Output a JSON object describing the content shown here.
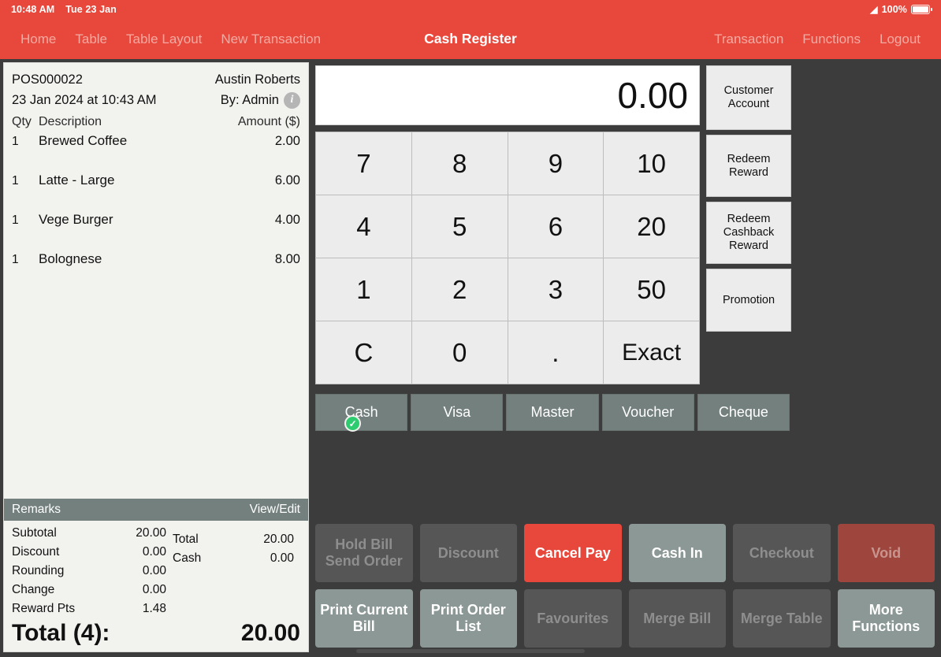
{
  "status_bar": {
    "time": "10:48 AM",
    "date": "Tue 23 Jan",
    "wifi_icon": "wifi-icon",
    "battery_percent": "100%"
  },
  "nav": {
    "title": "Cash Register",
    "left_items": [
      {
        "label": "Home",
        "name": "nav-home"
      },
      {
        "label": "Table",
        "name": "nav-table"
      },
      {
        "label": "Table Layout",
        "name": "nav-table-layout"
      },
      {
        "label": "New Transaction",
        "name": "nav-new-transaction"
      }
    ],
    "right_items": [
      {
        "label": "Transaction",
        "name": "nav-transaction"
      },
      {
        "label": "Functions",
        "name": "nav-functions"
      },
      {
        "label": "Logout",
        "name": "nav-logout"
      }
    ]
  },
  "receipt": {
    "order_no": "POS000022",
    "customer": "Austin Roberts",
    "datetime": "23 Jan 2024 at 10:43 AM",
    "by": "By: Admin",
    "info_icon": "info-icon",
    "columns": {
      "qty": "Qty",
      "description": "Description",
      "amount": "Amount ($)"
    },
    "items": [
      {
        "qty": "1",
        "description": "Brewed Coffee",
        "amount": "2.00"
      },
      {
        "qty": "1",
        "description": "Latte - Large",
        "amount": "6.00"
      },
      {
        "qty": "1",
        "description": "Vege Burger",
        "amount": "4.00"
      },
      {
        "qty": "1",
        "description": "Bolognese",
        "amount": "8.00"
      }
    ],
    "remarks_label": "Remarks",
    "remarks_action": "View/Edit",
    "totals_left": [
      {
        "label": "Subtotal",
        "value": "20.00"
      },
      {
        "label": "Discount",
        "value": "0.00"
      },
      {
        "label": "Rounding",
        "value": "0.00"
      },
      {
        "label": "Change",
        "value": "0.00"
      },
      {
        "label": "Reward Pts",
        "value": "1.48"
      }
    ],
    "totals_right": [
      {
        "label": "Total",
        "value": "20.00"
      },
      {
        "label": "Cash",
        "value": "0.00"
      }
    ],
    "grand_label": "Total (4):",
    "grand_value": "20.00"
  },
  "keypad": {
    "display_value": "0.00",
    "keys": [
      "7",
      "8",
      "9",
      "10",
      "4",
      "5",
      "6",
      "20",
      "1",
      "2",
      "3",
      "50",
      "C",
      "0",
      ".",
      "Exact"
    ]
  },
  "side_buttons": [
    {
      "label": "Customer Account",
      "name": "customer-account-button"
    },
    {
      "label": "Redeem Reward",
      "name": "redeem-reward-button"
    },
    {
      "label": "Redeem Cashback Reward",
      "name": "redeem-cashback-reward-button"
    },
    {
      "label": "Promotion",
      "name": "promotion-button"
    }
  ],
  "payment_methods": [
    {
      "label": "Cash",
      "selected": true,
      "name": "payment-cash"
    },
    {
      "label": "Visa",
      "selected": false,
      "name": "payment-visa"
    },
    {
      "label": "Master",
      "selected": false,
      "name": "payment-master"
    },
    {
      "label": "Voucher",
      "selected": false,
      "name": "payment-voucher"
    },
    {
      "label": "Cheque",
      "selected": false,
      "name": "payment-cheque"
    }
  ],
  "selected_check_icon": "check-icon",
  "actions": [
    {
      "label": "Hold Bill Send Order",
      "state": "disabled",
      "name": "hold-bill-send-order-button"
    },
    {
      "label": "Discount",
      "state": "disabled",
      "name": "discount-button"
    },
    {
      "label": "Cancel Pay",
      "state": "danger",
      "name": "cancel-pay-button"
    },
    {
      "label": "Cash In",
      "state": "enabled",
      "name": "cash-in-button"
    },
    {
      "label": "Checkout",
      "state": "disabled",
      "name": "checkout-button"
    },
    {
      "label": "Void",
      "state": "void",
      "name": "void-button"
    },
    {
      "label": "Print Current Bill",
      "state": "enabled",
      "name": "print-current-bill-button"
    },
    {
      "label": "Print Order List",
      "state": "enabled",
      "name": "print-order-list-button"
    },
    {
      "label": "Favourites",
      "state": "disabled",
      "name": "favourites-button"
    },
    {
      "label": "Merge Bill",
      "state": "disabled",
      "name": "merge-bill-button"
    },
    {
      "label": "Merge Table",
      "state": "disabled",
      "name": "merge-table-button"
    },
    {
      "label": "More Functions",
      "state": "enabled",
      "name": "more-functions-button"
    }
  ],
  "colors": {
    "header_red": "#e8483c",
    "background": "#3c3c3c",
    "receipt_paper": "#f2f2ef",
    "payment_gray": "#73807e",
    "enabled_action": "#8b9895",
    "disabled_action": "#565656",
    "void_red": "#9e463d",
    "check_green": "#2ecc71"
  }
}
